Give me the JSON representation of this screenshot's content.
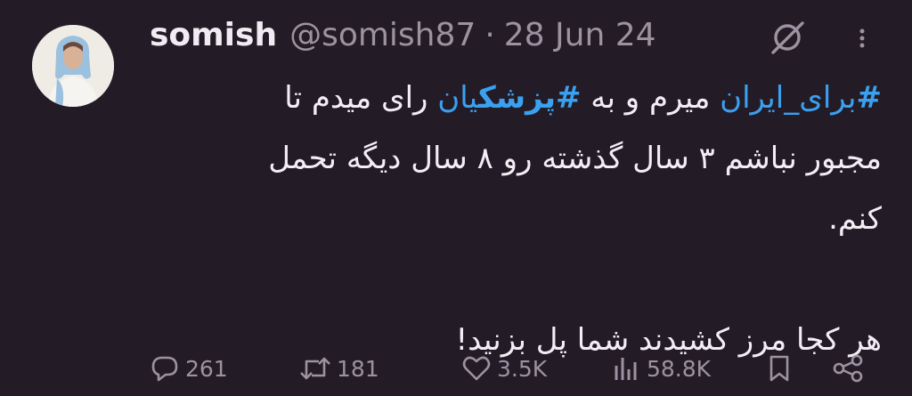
{
  "tweet": {
    "display_name": "somish",
    "handle": "@somish87",
    "separator": "·",
    "date": "28 Jun 24",
    "body": {
      "hashtag1_hash": "#",
      "hashtag1_word": "برای_ایران",
      "text1": " میرم و به ",
      "hashtag2_hash": "#",
      "hashtag2_bold": "پزشک",
      "hashtag2_rest": "یان",
      "text2": " رای میدم تا",
      "line2": "مجبور نباشم ۳ سال گذشته رو ۸ سال دیگه تحمل",
      "line3": "کنم.",
      "line5": "هر کجا مرز کشیدند شما پل بزنید!"
    }
  },
  "actions": {
    "replies": "261",
    "retweets": "181",
    "likes": "3.5K",
    "views": "58.8K"
  },
  "icons": {
    "grok": "grok-icon",
    "more": "more-dots-icon",
    "reply": "reply-icon",
    "retweet": "retweet-icon",
    "like": "heart-icon",
    "views": "views-icon",
    "bookmark": "bookmark-icon",
    "share": "share-icon"
  },
  "colors": {
    "background": "#231c27",
    "hashtag": "#3aa0f0",
    "muted": "#9c92a1"
  }
}
